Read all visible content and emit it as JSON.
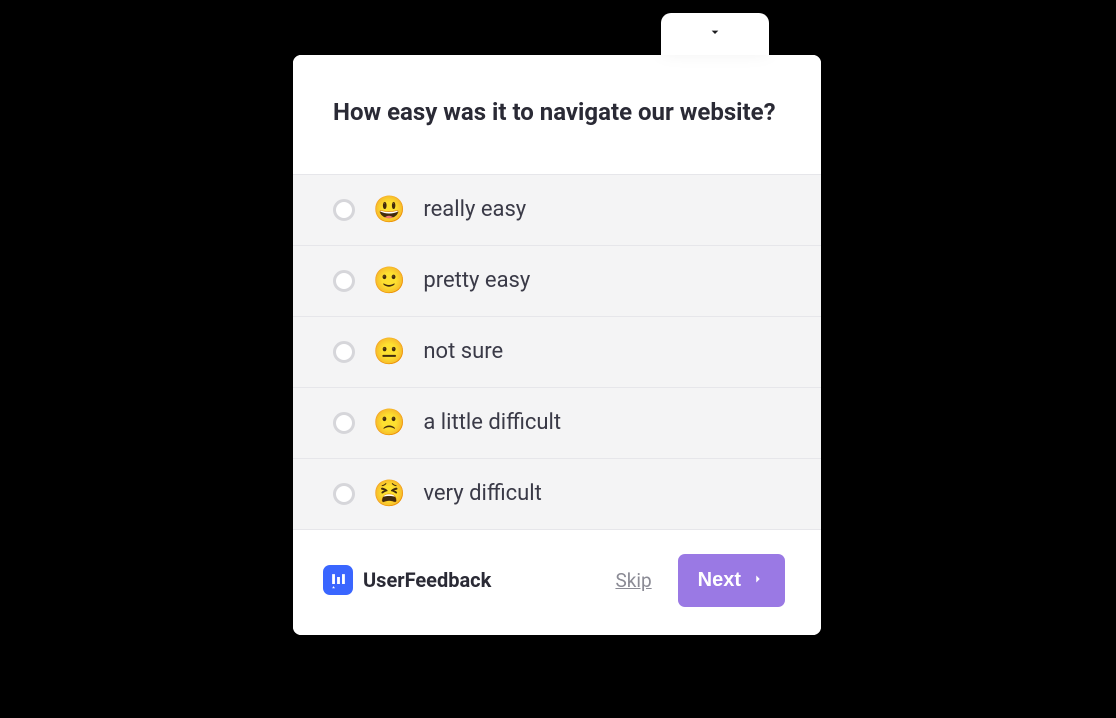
{
  "question": {
    "title": "How easy was it to navigate our website?"
  },
  "options": [
    {
      "emoji": "😃",
      "label": "really easy"
    },
    {
      "emoji": "🙂",
      "label": "pretty easy"
    },
    {
      "emoji": "😐",
      "label": "not sure"
    },
    {
      "emoji": "🙁",
      "label": "a little difficult"
    },
    {
      "emoji": "😫",
      "label": "very difficult"
    }
  ],
  "footer": {
    "brand": "UserFeedback",
    "skip": "Skip",
    "next": "Next"
  }
}
